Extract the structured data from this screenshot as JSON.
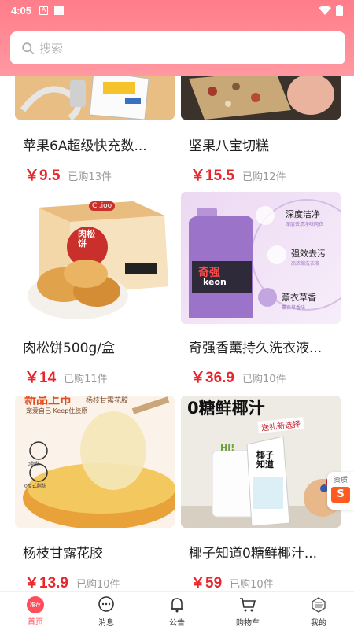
{
  "status_bar": {
    "time": "4:05",
    "a_icon": "A"
  },
  "search": {
    "placeholder": "搜索"
  },
  "products": [
    {
      "title": "苹果6A超级快充数...",
      "price": "￥9.5",
      "sold": "已购13件",
      "image": "charging-cable"
    },
    {
      "title": "坚果八宝切糕",
      "price": "￥15.5",
      "sold": "已购12件",
      "image": "nut-cake"
    },
    {
      "title": "肉松饼500g/盒",
      "price": "￥14",
      "sold": "已购11件",
      "image": "pork-floss-cake-box",
      "image_text": {
        "brand": "Ci.ioo",
        "pack": "肉松饼"
      }
    },
    {
      "title": "奇强香薰持久洗衣液...",
      "price": "￥36.9",
      "sold": "已购10件",
      "image": "laundry-detergent",
      "image_text": {
        "f1": "深度洁净",
        "f1_sub": "深层去渍净味网衣",
        "f2": "强效去污",
        "f2_sub": "高浓缩洗衣液",
        "f3": "薰衣草香",
        "f3_sub": "薰衣草香味",
        "brand": "奇强",
        "keon": "keon"
      }
    },
    {
      "title": "杨枝甘露花胶",
      "price": "￥13.9",
      "sold": "已购10件",
      "image": "mango-dessert",
      "image_text": {
        "headline": "新品上市",
        "sub": "杨枝甘露花胶",
        "line2": "宠爱自己 Keep住胶原",
        "b1": "0脂肪",
        "b2": "0反式脂肪"
      }
    },
    {
      "title": "椰子知道0糖鲜椰汁...",
      "price": "￥59",
      "sold": "已购10件",
      "image": "coconut-juice",
      "image_text": {
        "headline": "0糖鲜椰汁",
        "ribbon": "送礼新选择",
        "carton": "椰子知道",
        "hi": "HI!"
      }
    }
  ],
  "float_badge": {
    "text": "资质",
    "letter": "S"
  },
  "tabbar": [
    {
      "label": "首页",
      "icon": "home-icon",
      "active": true,
      "badge": "推荐"
    },
    {
      "label": "消息",
      "icon": "message-icon",
      "active": false
    },
    {
      "label": "公告",
      "icon": "bell-icon",
      "active": false
    },
    {
      "label": "购物车",
      "icon": "cart-icon",
      "active": false
    },
    {
      "label": "我的",
      "icon": "profile-icon",
      "active": false
    }
  ],
  "colors": {
    "accent": "#ff4d5a",
    "price": "#e8262c",
    "header": "#ff8b95"
  }
}
